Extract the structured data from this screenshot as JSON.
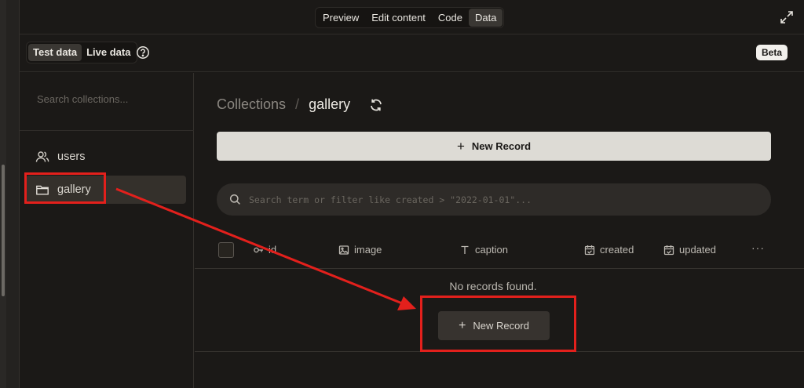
{
  "top_tabs": [
    {
      "label": "Preview",
      "active": false
    },
    {
      "label": "Edit content",
      "active": false
    },
    {
      "label": "Code",
      "active": false
    },
    {
      "label": "Data",
      "active": true
    }
  ],
  "data_toggle": {
    "options": [
      {
        "label": "Test data",
        "active": true
      },
      {
        "label": "Live data",
        "active": false
      }
    ]
  },
  "beta_badge": "Beta",
  "sidebar": {
    "search_placeholder": "Search collections...",
    "items": [
      {
        "label": "users",
        "icon": "users-icon",
        "selected": false
      },
      {
        "label": "gallery",
        "icon": "folder-icon",
        "selected": true
      }
    ]
  },
  "main": {
    "breadcrumb": {
      "root": "Collections",
      "separator": "/",
      "current": "gallery"
    },
    "new_record_label": "New Record",
    "search_placeholder": "Search term or filter like created > \"2022-01-01\"...",
    "columns": [
      {
        "label": "id",
        "icon": "key-icon"
      },
      {
        "label": "image",
        "icon": "image-icon"
      },
      {
        "label": "caption",
        "icon": "text-icon"
      },
      {
        "label": "created",
        "icon": "calendar-icon"
      },
      {
        "label": "updated",
        "icon": "calendar-icon"
      }
    ],
    "more_label": "···",
    "empty_text": "No records found.",
    "empty_button_label": "New Record"
  },
  "annotation": {
    "color": "#e3201c"
  }
}
